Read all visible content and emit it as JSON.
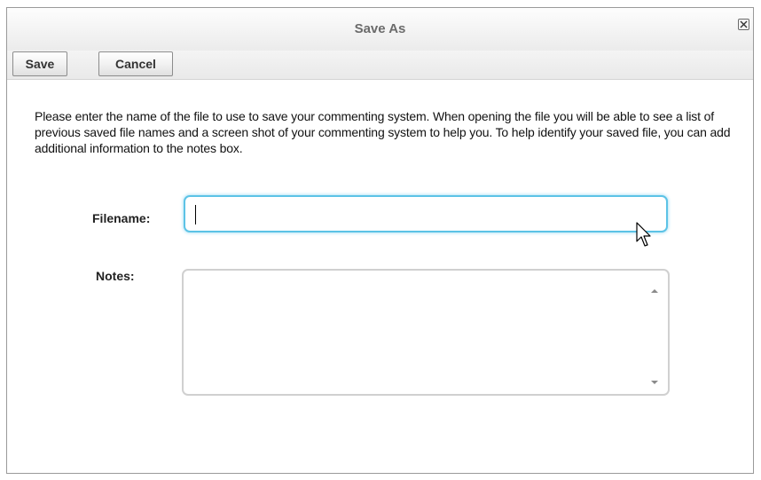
{
  "dialog": {
    "title": "Save As",
    "close_icon": "close-icon"
  },
  "toolbar": {
    "save_label": "Save",
    "cancel_label": "Cancel"
  },
  "instructions": "Please enter the name of the file to use to save your commenting system. When opening the file you will be able to see a list of previous saved file names and a screen shot of your commenting system to help you. To help identify your saved file, you can add additional information to the notes box.",
  "form": {
    "filename_label": "Filename:",
    "filename_value": "",
    "notes_label": "Notes:",
    "notes_value": ""
  },
  "colors": {
    "focus_border": "#5cc3e6",
    "title_text": "#6b6b6b"
  },
  "icons": {
    "close": "close-icon",
    "scroll_up": "chevron-up-icon",
    "scroll_down": "chevron-down-icon",
    "pointer": "mouse-pointer-icon"
  }
}
